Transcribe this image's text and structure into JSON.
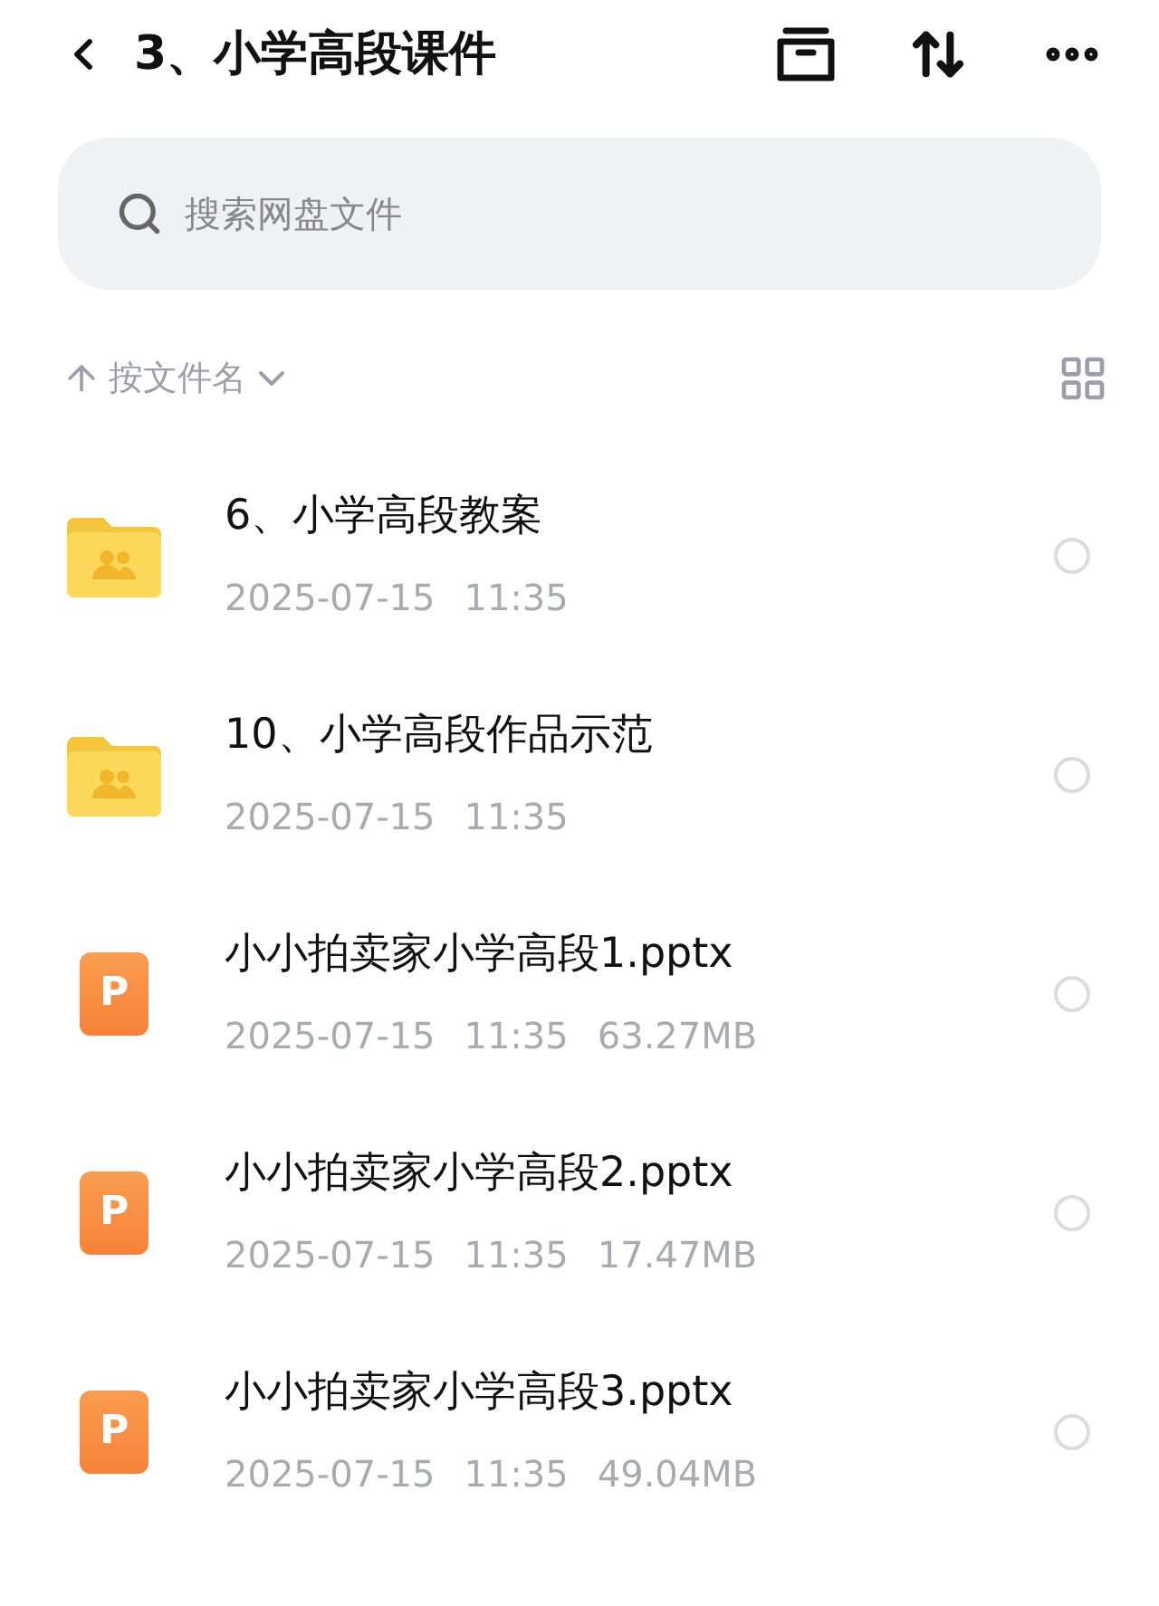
{
  "header": {
    "title": "3、小学高段课件"
  },
  "search": {
    "placeholder": "搜索网盘文件"
  },
  "sort": {
    "label": "按文件名"
  },
  "files": [
    {
      "kind": "folder",
      "name": "6、小学高段教案",
      "date": "2025-07-15",
      "time": "11:35",
      "selected": false
    },
    {
      "kind": "folder",
      "name": "10、小学高段作品示范",
      "date": "2025-07-15",
      "time": "11:35",
      "selected": false
    },
    {
      "kind": "pptx",
      "badge": "P",
      "name": "小小拍卖家小学高段1.pptx",
      "date": "2025-07-15",
      "time": "11:35",
      "size": "63.27MB",
      "selected": false
    },
    {
      "kind": "pptx",
      "badge": "P",
      "name": "小小拍卖家小学高段2.pptx",
      "date": "2025-07-15",
      "time": "11:35",
      "size": "17.47MB",
      "selected": false
    },
    {
      "kind": "pptx",
      "badge": "P",
      "name": "小小拍卖家小学高段3.pptx",
      "date": "2025-07-15",
      "time": "11:35",
      "size": "49.04MB",
      "selected": false
    }
  ]
}
